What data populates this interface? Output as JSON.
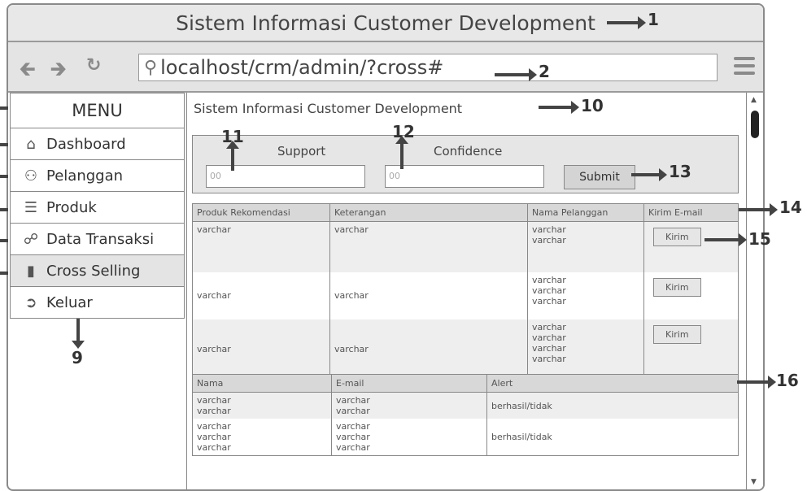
{
  "window": {
    "title": "Sistem Informasi Customer Development"
  },
  "browser": {
    "back_icon": "arrow-left",
    "forward_icon": "arrow-right",
    "reload_icon": "refresh",
    "url": "localhost/crm/admin/?cross#"
  },
  "sidebar": {
    "title": "MENU",
    "items": [
      {
        "label": "Dashboard",
        "icon": "home"
      },
      {
        "label": "Pelanggan",
        "icon": "users"
      },
      {
        "label": "Produk",
        "icon": "list"
      },
      {
        "label": "Data Transaksi",
        "icon": "link"
      },
      {
        "label": "Cross Selling",
        "icon": "file",
        "active": true
      },
      {
        "label": "Keluar",
        "icon": "sign-out"
      }
    ]
  },
  "content": {
    "title": "Sistem Informasi Customer Development",
    "form": {
      "support_label": "Support",
      "support_value": "00",
      "confidence_label": "Confidence",
      "confidence_value": "00",
      "submit_label": "Submit"
    },
    "table1": {
      "headers": [
        "Produk Rekomendasi",
        "Keterangan",
        "Nama Pelanggan",
        "Kirim E-mail"
      ],
      "rows": [
        {
          "produk": "varchar",
          "keterangan": "varchar",
          "pelanggan": [
            "varchar",
            "varchar"
          ],
          "button": "Kirim"
        },
        {
          "produk": "varchar",
          "keterangan": "varchar",
          "pelanggan": [
            "varchar",
            "varchar",
            "varchar"
          ],
          "button": "Kirim"
        },
        {
          "produk": "varchar",
          "keterangan": "varchar",
          "pelanggan": [
            "varchar",
            "varchar",
            "varchar",
            "varchar"
          ],
          "button": "Kirim"
        }
      ]
    },
    "table2": {
      "headers": [
        "Nama",
        "E-mail",
        "Alert"
      ],
      "rows": [
        {
          "nama": [
            "varchar",
            "varchar"
          ],
          "email": [
            "varchar",
            "varchar"
          ],
          "alert": "berhasil/tidak"
        },
        {
          "nama": [
            "varchar",
            "varchar",
            "varchar"
          ],
          "email": [
            "varchar",
            "varchar",
            "varchar"
          ],
          "alert": "berhasil/tidak"
        }
      ]
    }
  },
  "annotations": {
    "n1": "1",
    "n2": "2",
    "n9": "9",
    "n10": "10",
    "n11": "11",
    "n12": "12",
    "n13": "13",
    "n14": "14",
    "n15": "15",
    "n16": "16"
  }
}
